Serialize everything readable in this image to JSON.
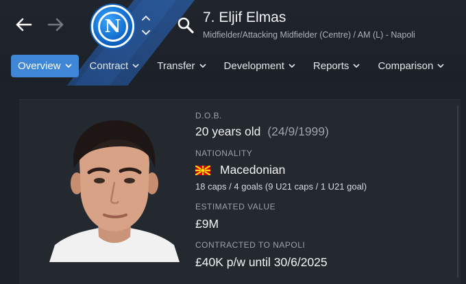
{
  "header": {
    "player_name": "7. Eljif Elmas",
    "player_subtitle": "Midfielder/Attacking Midfielder (Centre) / AM (L) - Napoli",
    "club_crest_letter": "N",
    "accent_color": "#3f86d6"
  },
  "tabs": [
    {
      "label": "Overview",
      "active": true
    },
    {
      "label": "Contract",
      "active": false
    },
    {
      "label": "Transfer",
      "active": false
    },
    {
      "label": "Development",
      "active": false
    },
    {
      "label": "Reports",
      "active": false
    },
    {
      "label": "Comparison",
      "active": false
    }
  ],
  "overview": {
    "dob_label": "D.O.B.",
    "age": "20 years old",
    "dob": "(24/9/1999)",
    "nationality_label": "NATIONALITY",
    "nationality": "Macedonian",
    "caps": "18 caps / 4 goals (9 U21 caps / 1 U21 goal)",
    "value_label": "ESTIMATED VALUE",
    "value": "£9M",
    "contract_label": "CONTRACTED TO NAPOLI",
    "contract": "£40K p/w until 30/6/2025"
  }
}
